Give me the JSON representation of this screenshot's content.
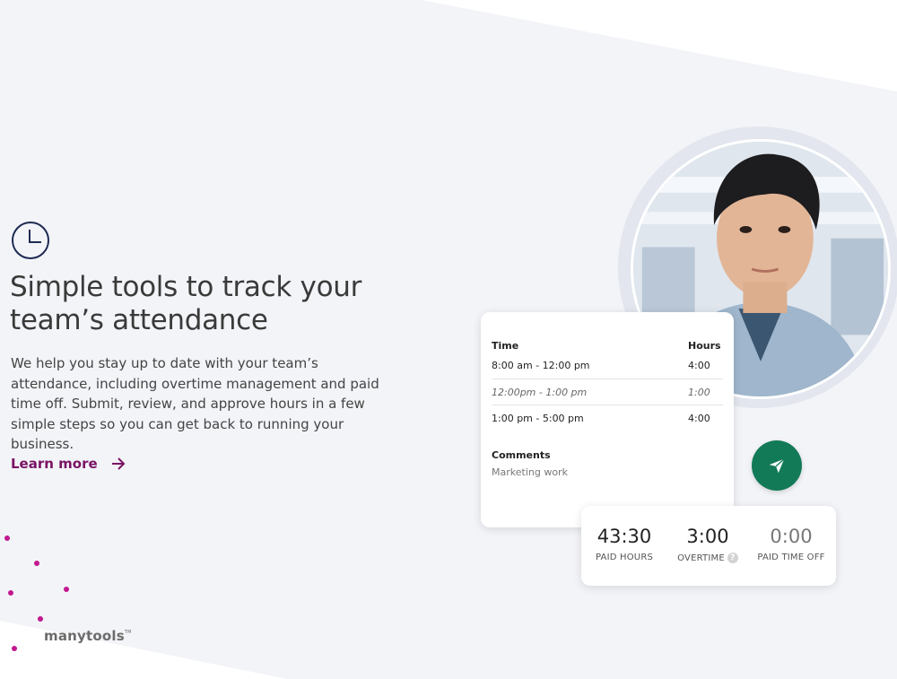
{
  "hero": {
    "headline": "Simple tools to track your team’s attendance",
    "body": "We help you stay up to date with your team’s attendance, including overtime management and paid time off. Submit, review, and approve hours in a few simple steps so you can get back to running your business.",
    "learn_more_label": "Learn more"
  },
  "timesheet": {
    "time_header": "Time",
    "hours_header": "Hours",
    "rows": [
      {
        "time": "8:00 am - 12:00 pm",
        "hours": "4:00"
      },
      {
        "time": "12:00pm - 1:00 pm",
        "hours": "1:00"
      },
      {
        "time": "1:00 pm - 5:00 pm",
        "hours": "4:00"
      }
    ],
    "comments_label": "Comments",
    "comments_value": "Marketing work"
  },
  "stats": [
    {
      "value": "43:30",
      "label": "PAID HOURS"
    },
    {
      "value": "3:00",
      "label": "OVERTIME"
    },
    {
      "value": "0:00",
      "label": "PAID TIME OFF"
    }
  ],
  "logo": {
    "text": "manytools",
    "mark": "TM"
  },
  "icons": {
    "clock": "clock-icon",
    "arrow": "arrow-right-icon",
    "send": "paper-plane-icon",
    "help": "question-icon"
  },
  "colors": {
    "accent": "#7a1464",
    "send_button": "#137a57",
    "dots": "#c2188f",
    "background": "#f3f4f8"
  }
}
